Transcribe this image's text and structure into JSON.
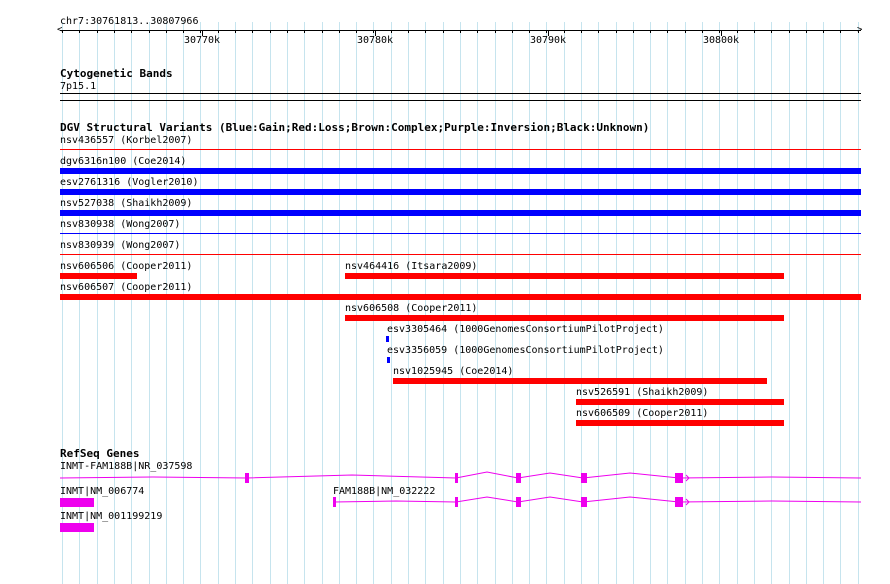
{
  "browser": {
    "location": "chr7:30761813..30807966",
    "ruler": {
      "labels": [
        "30770k",
        "30780k",
        "30790k",
        "30800k"
      ]
    }
  },
  "tracks": {
    "cytoband": {
      "title": "Cytogenetic Bands",
      "band": "7p15.1"
    },
    "dgv": {
      "title": "DGV Structural Variants (Blue:Gain;Red:Loss;Brown:Complex;Purple:Inversion;Black:Unknown)",
      "colors": {
        "gain": "#0000ff",
        "loss": "#ff0000",
        "complex": "#8b4513",
        "inversion": "#800080",
        "unknown": "#000000"
      },
      "features": [
        {
          "label": "nsv436557 (Korbel2007)",
          "type": "loss"
        },
        {
          "label": "dgv6316n100 (Coe2014)",
          "type": "gain"
        },
        {
          "label": "esv2761316 (Vogler2010)",
          "type": "gain"
        },
        {
          "label": "nsv527038 (Shaikh2009)",
          "type": "gain"
        },
        {
          "label": "nsv830938 (Wong2007)",
          "type": "gain"
        },
        {
          "label": "nsv830939 (Wong2007)",
          "type": "loss"
        },
        {
          "label": "nsv606506 (Cooper2011)",
          "type": "loss"
        },
        {
          "label": "nsv464416 (Itsara2009)",
          "type": "loss"
        },
        {
          "label": "nsv606507 (Cooper2011)",
          "type": "loss"
        },
        {
          "label": "nsv606508 (Cooper2011)",
          "type": "loss"
        },
        {
          "label": "esv3305464 (1000GenomesConsortiumPilotProject)",
          "type": "gain"
        },
        {
          "label": "esv3356059 (1000GenomesConsortiumPilotProject)",
          "type": "gain"
        },
        {
          "label": "nsv1025945 (Coe2014)",
          "type": "loss"
        },
        {
          "label": "nsv526591 (Shaikh2009)",
          "type": "loss"
        },
        {
          "label": "nsv606509 (Cooper2011)",
          "type": "loss"
        }
      ]
    },
    "refseq": {
      "title": "RefSeq Genes",
      "color": "#ee00ee",
      "genes": [
        {
          "label": "INMT-FAM188B|NR_037598"
        },
        {
          "label": "INMT|NM_006774"
        },
        {
          "label": "FAM188B|NM_032222"
        },
        {
          "label": "INMT|NM_001199219"
        }
      ]
    }
  }
}
